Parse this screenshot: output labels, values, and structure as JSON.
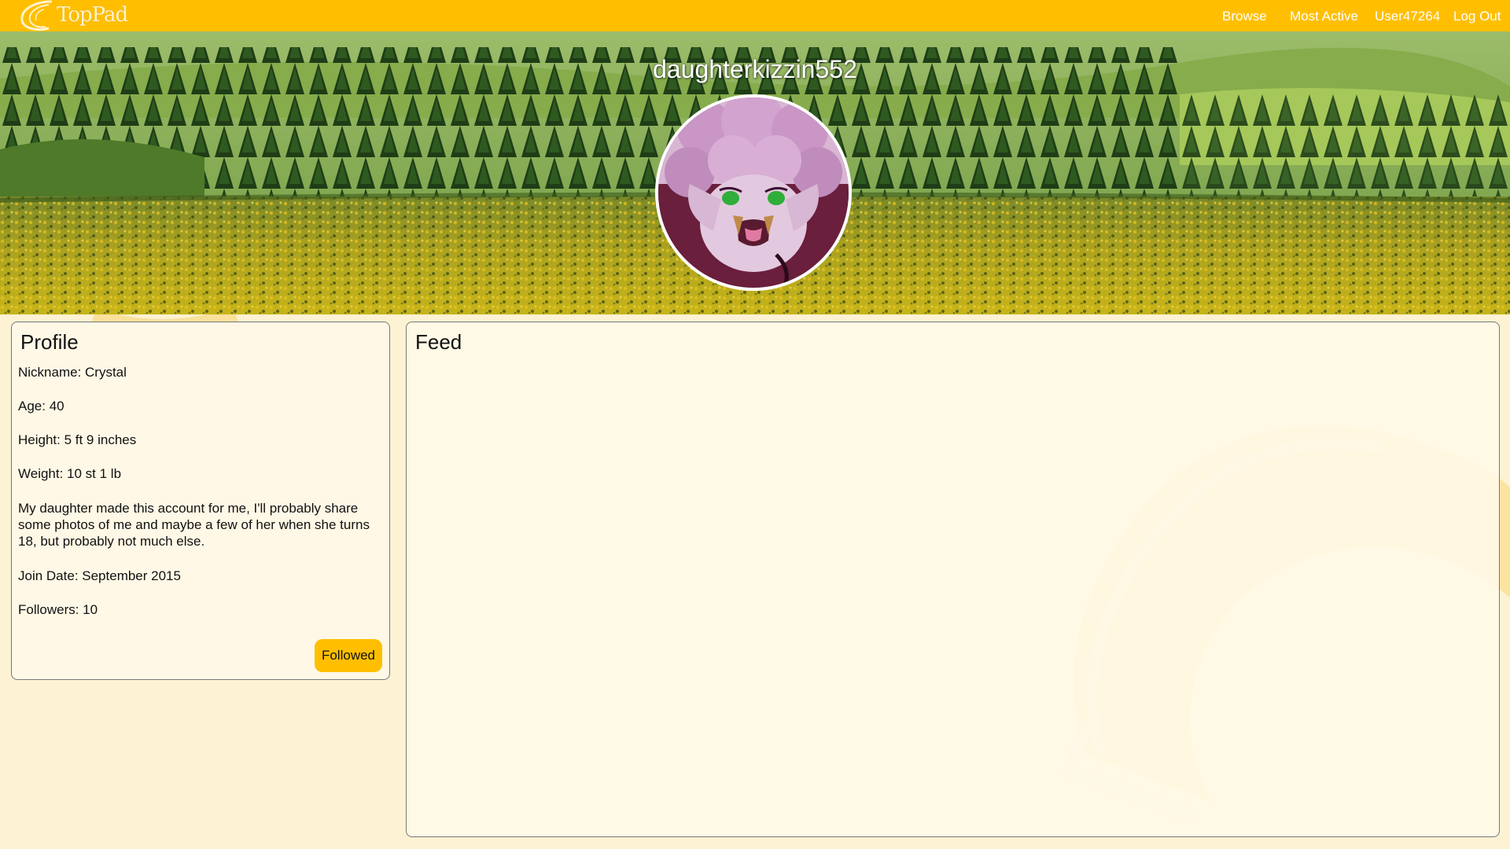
{
  "header": {
    "logo_text": "TopPad",
    "nav": {
      "browse": "Browse",
      "most_active": "Most Active",
      "user": "User47264",
      "logout": "Log Out"
    }
  },
  "profile_header": {
    "username": "daughterkizzin552"
  },
  "profile": {
    "title": "Profile",
    "nickname": "Nickname: Crystal",
    "age": "Age: 40",
    "height": "Height: 5 ft 9 inches",
    "weight": "Weight: 10 st 1 lb",
    "bio": "My daughter made this account for me, I'll probably share some photos of me and maybe a few of her when she turns 18, but probably not much else.",
    "join_date": "Join Date: September 2015",
    "followers": "Followers: 10",
    "follow_button": "Followed"
  },
  "feed": {
    "title": "Feed"
  },
  "colors": {
    "brand": "#ffbf00",
    "page_background": "#fdf2d3",
    "panel_background": "#fff8e6"
  }
}
